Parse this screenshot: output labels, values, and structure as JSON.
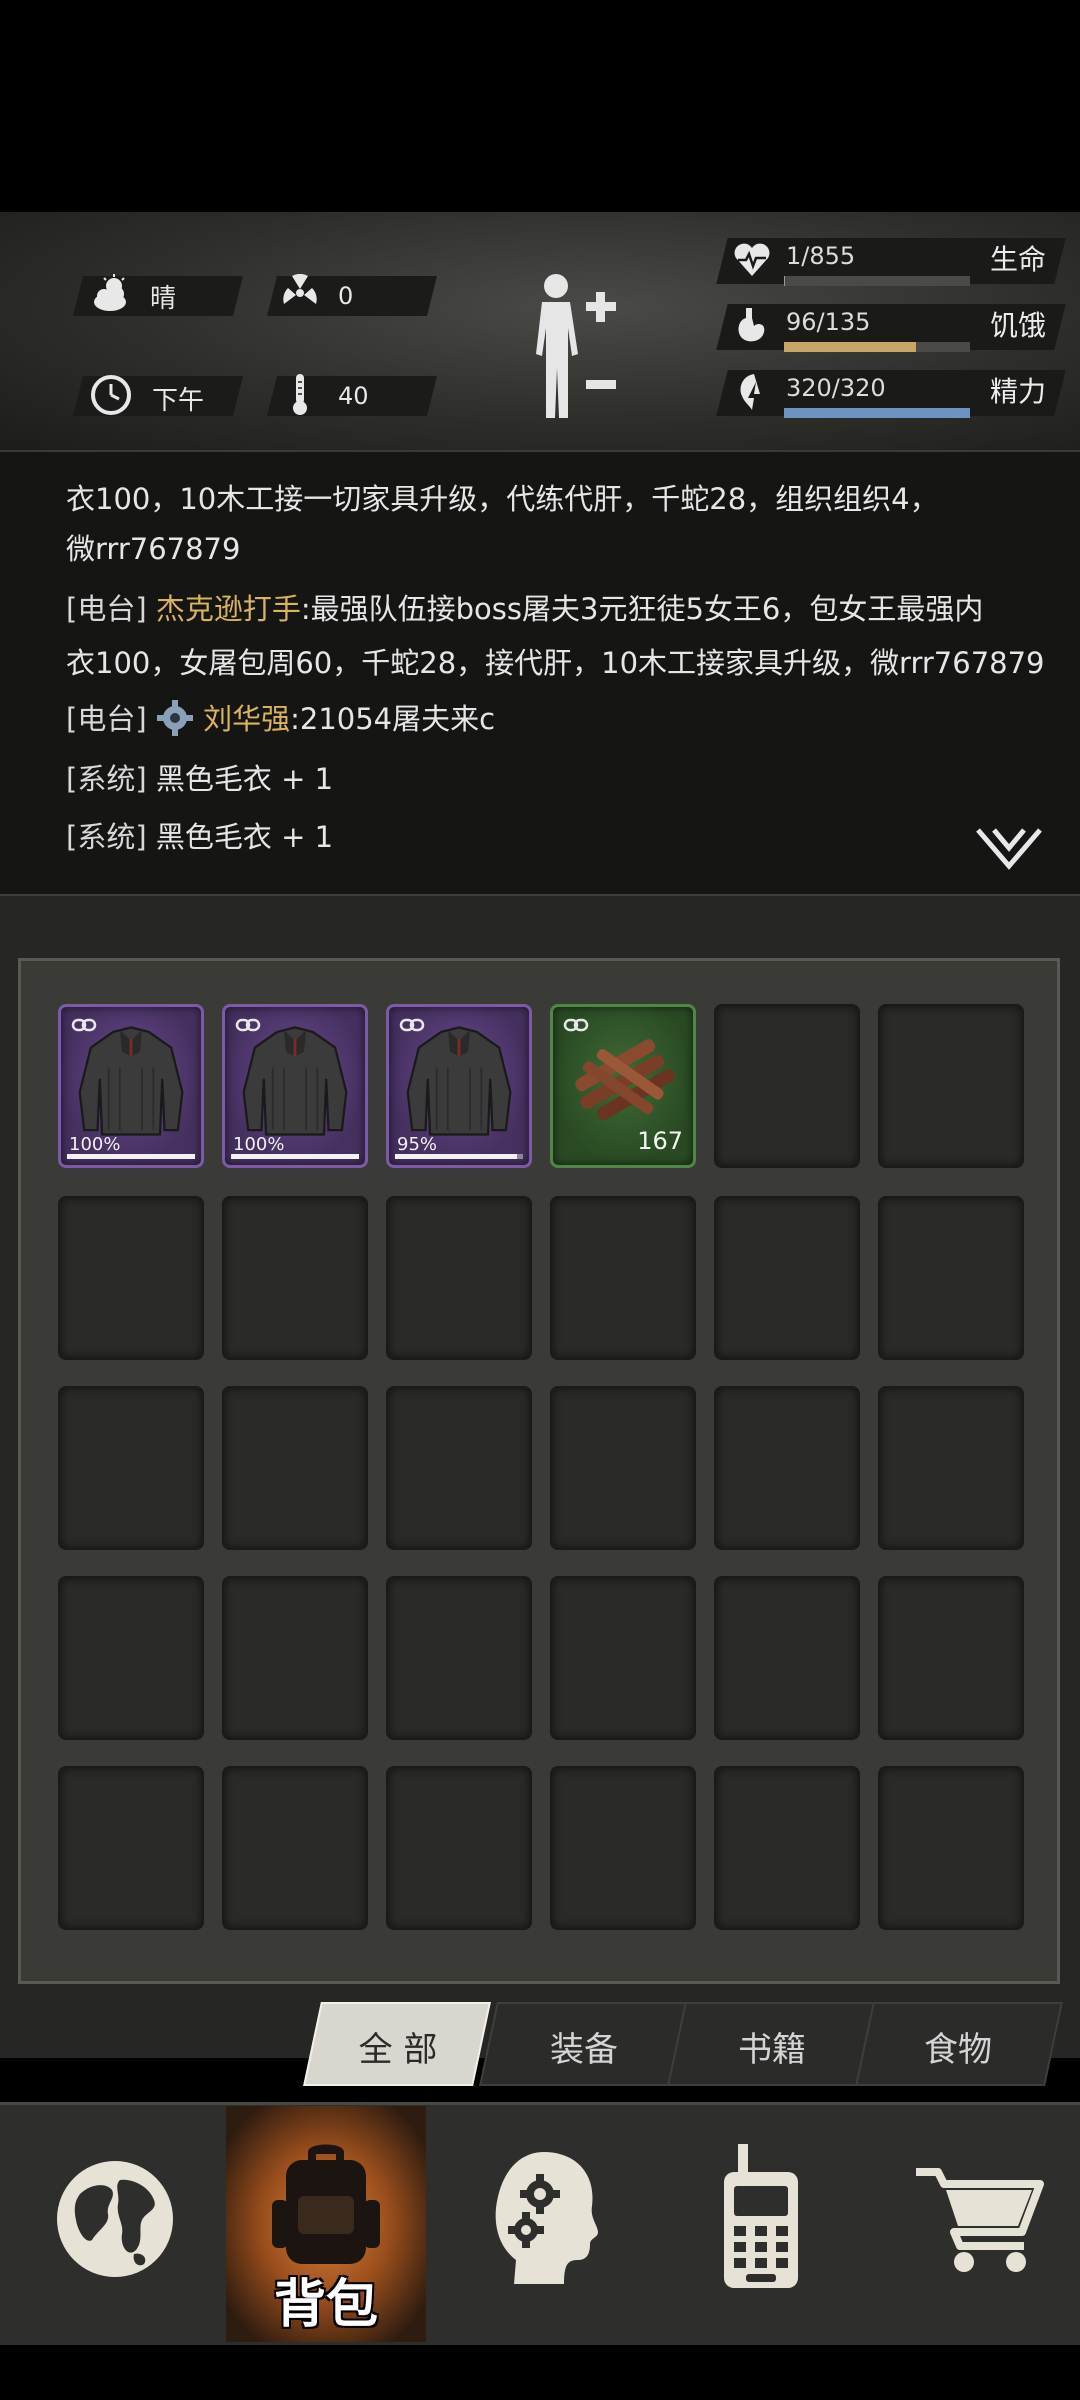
{
  "status": {
    "weather": {
      "icon": "sun-cloud-icon",
      "label": "晴"
    },
    "radiation": {
      "icon": "radiation-icon",
      "value": "0"
    },
    "time_of_day": {
      "icon": "clock-icon",
      "label": "下午"
    },
    "temperature": {
      "icon": "thermometer-icon",
      "value": "40"
    },
    "stats": [
      {
        "id": "health",
        "icon": "heart-icon",
        "value": "1/855",
        "label": "生命",
        "fraction": 0.0012,
        "color": "#9a9a96"
      },
      {
        "id": "hunger",
        "icon": "stomach-icon",
        "value": "96/135",
        "label": "饥饿",
        "fraction": 0.711,
        "color": "#c9a566"
      },
      {
        "id": "energy",
        "icon": "energy-icon",
        "value": "320/320",
        "label": "精力",
        "fraction": 1.0,
        "color": "#6f93c0"
      }
    ]
  },
  "chat": {
    "lines": [
      {
        "text": "衣100，10木工接一切家具升级，代练代肝，千蛇28，组织组织4，"
      },
      {
        "text": "微rrr767879"
      },
      {
        "tag": "[电台]",
        "name": "杰克逊打手",
        "text": ":最强队伍接boss屠夫3元狂徒5女王6，包女王最强内"
      },
      {
        "text": "衣100，女屠包周60，千蛇28，接代肝，10木工接家具升级，微rrr767879"
      },
      {
        "tag": "[电台]",
        "name": "刘华强",
        "text": ":21054屠夫来c"
      },
      {
        "tag": "[系统]",
        "text": "黑色毛衣 + 1"
      },
      {
        "tag": "[系统]",
        "text": "黑色毛衣 + 1"
      }
    ],
    "collapse_icon": "double-chevron-down-icon"
  },
  "inventory": {
    "items": [
      {
        "name": "黑色毛衣",
        "icon": "black-sweater-icon",
        "rarity": "purple",
        "durability": "100%",
        "durability_fraction": 1.0,
        "linked": true
      },
      {
        "name": "黑色毛衣",
        "icon": "black-sweater-icon",
        "rarity": "purple",
        "durability": "100%",
        "durability_fraction": 1.0,
        "linked": true
      },
      {
        "name": "黑色毛衣",
        "icon": "black-sweater-icon",
        "rarity": "purple",
        "durability": "95%",
        "durability_fraction": 0.95,
        "linked": true
      },
      {
        "name": "木材",
        "icon": "wood-bundle-icon",
        "rarity": "green",
        "quantity": "167",
        "linked": true
      }
    ],
    "total_slots": 30
  },
  "tabs": [
    {
      "label": "全 部",
      "active": true
    },
    {
      "label": "装备",
      "active": false
    },
    {
      "label": "书籍",
      "active": false
    },
    {
      "label": "食物",
      "active": false
    }
  ],
  "nav": [
    {
      "icon": "globe-icon",
      "label": ""
    },
    {
      "icon": "backpack-icon",
      "label": "背包",
      "active": true
    },
    {
      "icon": "head-gears-icon",
      "label": ""
    },
    {
      "icon": "walkie-talkie-icon",
      "label": ""
    },
    {
      "icon": "cart-icon",
      "label": ""
    }
  ]
}
